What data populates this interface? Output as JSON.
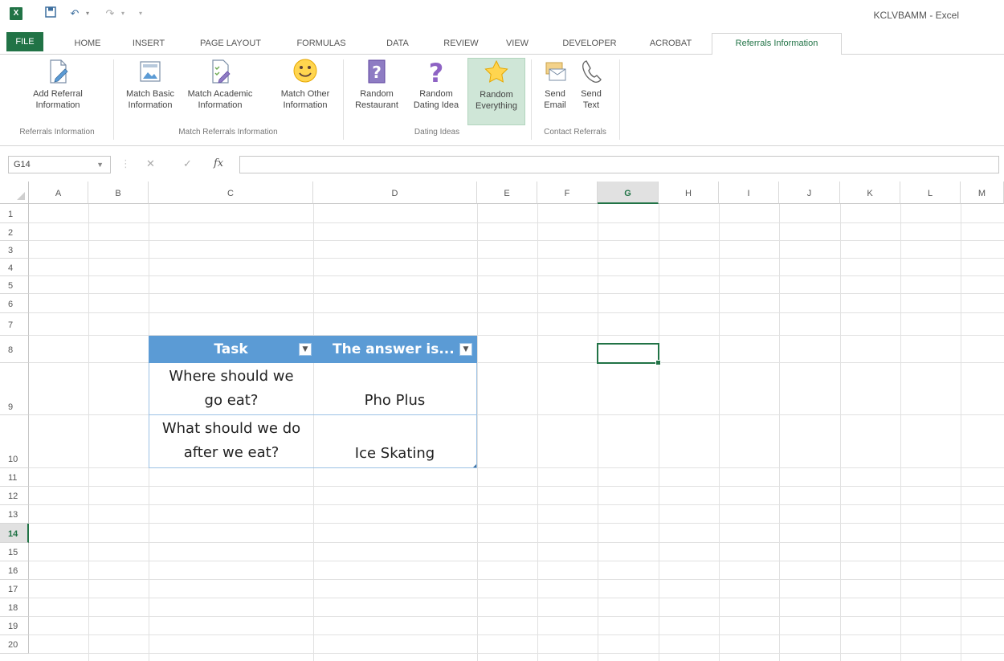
{
  "app": {
    "window_title": "KCLVBAMM - Excel",
    "accent_color": "#217346",
    "table_header_color": "#5b9bd5"
  },
  "quick_access": {
    "icons": [
      "excel-logo-icon",
      "save-icon",
      "undo-icon",
      "redo-icon",
      "customize-icon"
    ]
  },
  "tabs": [
    {
      "label": "FILE"
    },
    {
      "label": "HOME"
    },
    {
      "label": "INSERT"
    },
    {
      "label": "PAGE LAYOUT"
    },
    {
      "label": "FORMULAS"
    },
    {
      "label": "DATA"
    },
    {
      "label": "REVIEW"
    },
    {
      "label": "VIEW"
    },
    {
      "label": "DEVELOPER"
    },
    {
      "label": "ACROBAT"
    },
    {
      "label": "Referrals Information",
      "active": true
    }
  ],
  "ribbon": {
    "groups": [
      {
        "label": "Referrals Information"
      },
      {
        "label": "Match Referrals Information"
      },
      {
        "label": "Dating Ideas"
      },
      {
        "label": "Contact Referrals"
      }
    ],
    "buttons": [
      {
        "line1": "Add Referral",
        "line2": "Information",
        "icon": "document-pencil-icon"
      },
      {
        "line1": "Match Basic",
        "line2": "Information",
        "icon": "picture-document-icon"
      },
      {
        "line1": "Match Academic",
        "line2": "Information",
        "icon": "checklist-pencil-icon"
      },
      {
        "line1": "Match Other",
        "line2": "Information",
        "icon": "smiley-icon"
      },
      {
        "line1": "Random",
        "line2": "Restaurant",
        "icon": "question-box-icon"
      },
      {
        "line1": "Random",
        "line2": "Dating Idea",
        "icon": "question-mark-icon"
      },
      {
        "line1": "Random",
        "line2": "Everything",
        "icon": "star-icon",
        "selected": true
      },
      {
        "line1": "Send",
        "line2": "Email",
        "icon": "email-icon"
      },
      {
        "line1": "Send",
        "line2": "Text",
        "icon": "phone-icon"
      }
    ]
  },
  "formula_bar": {
    "name_box": "G14",
    "fx_label": "fx",
    "value": ""
  },
  "grid": {
    "columns": [
      "A",
      "B",
      "C",
      "D",
      "E",
      "F",
      "G",
      "H",
      "I",
      "J",
      "K",
      "L",
      "M"
    ],
    "selected_column": "G",
    "rows": [
      "1",
      "2",
      "3",
      "4",
      "5",
      "6",
      "7",
      "8",
      "9",
      "10",
      "11",
      "12",
      "13",
      "14",
      "15",
      "16",
      "17",
      "18",
      "19",
      "20"
    ],
    "selected_row": "14",
    "selected_cell": "G14"
  },
  "table": {
    "headers": [
      "Task",
      "The answer is..."
    ],
    "rows": [
      {
        "task_line1": "Where should we",
        "task_line2": "go eat?",
        "answer": "Pho Plus"
      },
      {
        "task_line1": "What should we do",
        "task_line2": "after we eat?",
        "answer": "Ice Skating"
      }
    ]
  }
}
